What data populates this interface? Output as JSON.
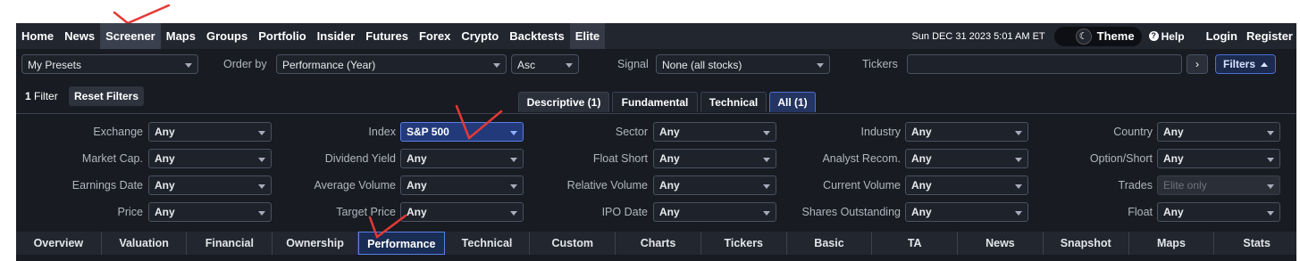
{
  "nav": {
    "items": [
      "Home",
      "News",
      "Screener",
      "Maps",
      "Groups",
      "Portfolio",
      "Insider",
      "Futures",
      "Forex",
      "Crypto",
      "Backtests",
      "Elite"
    ],
    "active": "Screener",
    "datetime": "Sun DEC 31 2023 5:01 AM ET",
    "theme_label": "Theme",
    "help_label": "Help",
    "login_label": "Login",
    "register_label": "Register"
  },
  "controls": {
    "presets_value": "My Presets",
    "order_by_label": "Order by",
    "order_by_value": "Performance (Year)",
    "order_dir_value": "Asc",
    "signal_label": "Signal",
    "signal_value": "None (all stocks)",
    "tickers_label": "Tickers",
    "tickers_value": "",
    "go_arrow": "›",
    "filters_button": "Filters"
  },
  "filter_summary": {
    "count": "1",
    "count_label": "Filter",
    "reset_label": "Reset Filters"
  },
  "filter_tabs": [
    "Descriptive (1)",
    "Fundamental",
    "Technical",
    "All (1)"
  ],
  "filters": {
    "exchange": {
      "label": "Exchange",
      "value": "Any"
    },
    "index": {
      "label": "Index",
      "value": "S&P 500"
    },
    "sector": {
      "label": "Sector",
      "value": "Any"
    },
    "industry": {
      "label": "Industry",
      "value": "Any"
    },
    "country": {
      "label": "Country",
      "value": "Any"
    },
    "market_cap": {
      "label": "Market Cap.",
      "value": "Any"
    },
    "dividend_yield": {
      "label": "Dividend Yield",
      "value": "Any"
    },
    "float_short": {
      "label": "Float Short",
      "value": "Any"
    },
    "analyst_recom": {
      "label": "Analyst Recom.",
      "value": "Any"
    },
    "option_short": {
      "label": "Option/Short",
      "value": "Any"
    },
    "earnings_date": {
      "label": "Earnings Date",
      "value": "Any"
    },
    "average_volume": {
      "label": "Average Volume",
      "value": "Any"
    },
    "relative_volume": {
      "label": "Relative Volume",
      "value": "Any"
    },
    "current_volume": {
      "label": "Current Volume",
      "value": "Any"
    },
    "trades": {
      "label": "Trades",
      "value": "Elite only"
    },
    "price": {
      "label": "Price",
      "value": "Any"
    },
    "target_price": {
      "label": "Target Price",
      "value": "Any"
    },
    "ipo_date": {
      "label": "IPO Date",
      "value": "Any"
    },
    "shares_outstanding": {
      "label": "Shares Outstanding",
      "value": "Any"
    },
    "float": {
      "label": "Float",
      "value": "Any"
    }
  },
  "view_tabs": [
    "Overview",
    "Valuation",
    "Financial",
    "Ownership",
    "Performance",
    "Technical",
    "Custom",
    "Charts",
    "Tickers",
    "Basic",
    "TA",
    "News",
    "Snapshot",
    "Maps",
    "Stats"
  ],
  "active_view": "Performance",
  "colors": {
    "annotation": "#e53935",
    "accent": "#4a6fd6"
  }
}
